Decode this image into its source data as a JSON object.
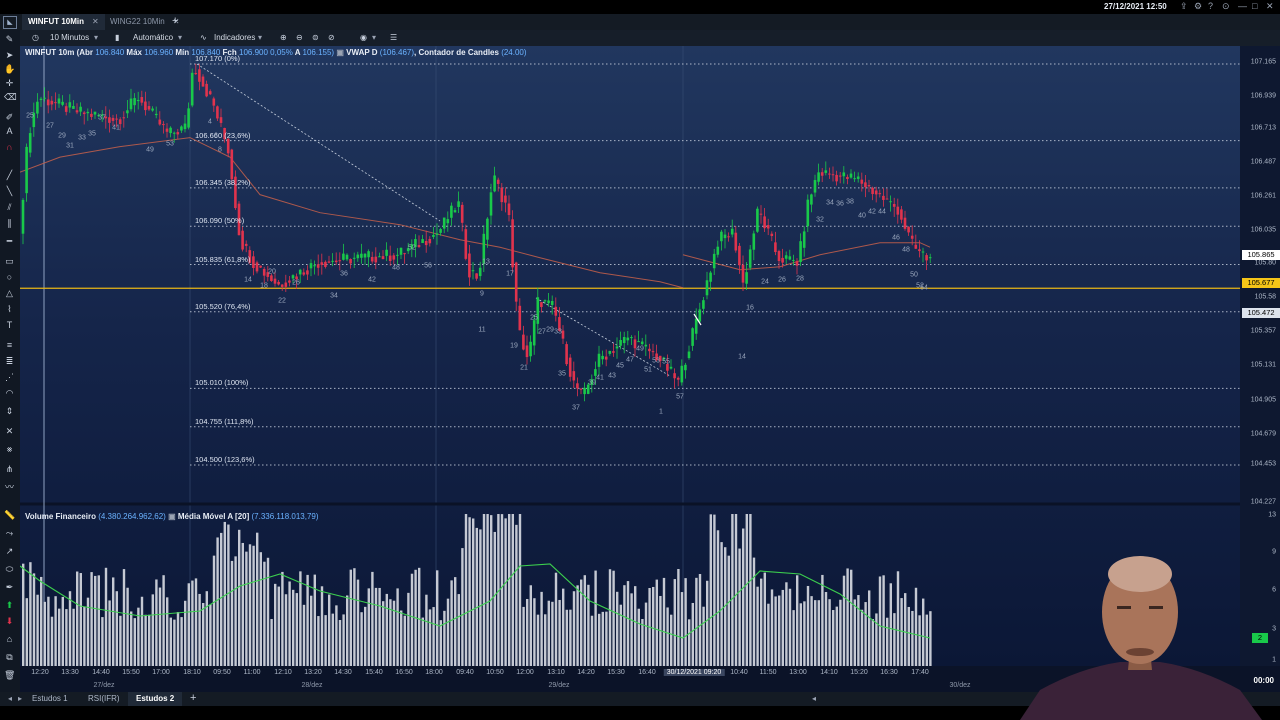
{
  "topbar": {
    "datetime": "27/12/2021 12:50"
  },
  "tabs": [
    {
      "label": "WINFUT 10Min",
      "active": true
    },
    {
      "label": "WING22 10Min",
      "active": false
    }
  ],
  "toolbar": {
    "interval": "10 Minutos",
    "mode": "Automático",
    "indicators": "Indicadores"
  },
  "legend_main": {
    "symbol": "WINFUT 10m",
    "abr_label": "(Abr",
    "abr": "106.840",
    "max_label": "Máx",
    "max": "106.960",
    "min_label": "Mín",
    "min": "106.840",
    "fch_label": "Fch",
    "fch": "106.900",
    "change": "0,05%",
    "a_label": "A",
    "a": "106.155)",
    "vwap_label": "VWAP D",
    "vwap": "(106.467)",
    "candles_label": "Contador de Candles",
    "candles": "(24.00)"
  },
  "legend_volume": {
    "label": "Volume Financeiro",
    "value": "(4.380.264.962,62)",
    "ma_label": "Média Móvel A [20]",
    "ma_value": "(7.336.118.013,79)"
  },
  "fib_levels": [
    {
      "label": "107.170 (0%)",
      "price": 107.17
    },
    {
      "label": "106.660 (23,6%)",
      "price": 106.66
    },
    {
      "label": "106.345 (38,2%)",
      "price": 106.345
    },
    {
      "label": "106.090 (50%)",
      "price": 106.09
    },
    {
      "label": "105.835 (61,8%)",
      "price": 105.835
    },
    {
      "label": "105.520 (76,4%)",
      "price": 105.52
    },
    {
      "label": "105.010 (100%)",
      "price": 105.01
    },
    {
      "label": "104.755 (111,8%)",
      "price": 104.755
    },
    {
      "label": "104.500 (123,6%)",
      "price": 104.5
    }
  ],
  "price_axis": {
    "labels": [
      "107.165",
      "106.939",
      "106.713",
      "106.487",
      "106.261",
      "106.035",
      "105.80",
      "105.58",
      "105.357",
      "105.131",
      "104.905",
      "104.679",
      "104.453",
      "104.227"
    ],
    "badges": [
      {
        "value": "105.865",
        "color": "#ffffff",
        "text_color": "#000000"
      },
      {
        "value": "105.677",
        "color": "#f5c518",
        "text_color": "#000000"
      },
      {
        "value": "105.472",
        "color": "#dde3ec",
        "text_color": "#000000"
      }
    ],
    "volume_labels": [
      "13",
      "9",
      "6",
      "3",
      "1"
    ],
    "volume_badge": "2",
    "volume_badge_color": "#19c94a"
  },
  "time_axis": {
    "labels": [
      "12:20",
      "13:30",
      "14:40",
      "15:50",
      "17:00",
      "18:10",
      "09:50",
      "11:00",
      "12:10",
      "13:20",
      "14:30",
      "15:40",
      "16:50",
      "18:00",
      "09:40",
      "10:50",
      "12:00",
      "13:10",
      "14:20",
      "15:30",
      "16:40",
      "30/12/2021 09:20",
      "10:40",
      "11:50",
      "13:00",
      "14:10",
      "15:20",
      "16:30",
      "17:40"
    ],
    "dates": [
      "27/dez",
      "28/dez",
      "29/dez",
      "30/dez"
    ],
    "clock": "00:00"
  },
  "bottom_tabs": [
    {
      "label": "Estudos 1",
      "active": false
    },
    {
      "label": "RSI(IFR)",
      "active": false
    },
    {
      "label": "Estudos 2",
      "active": true
    }
  ],
  "candle_counts": [
    "25",
    "27",
    "29",
    "31",
    "33",
    "35",
    "37",
    "41",
    "49",
    "53",
    "4",
    "6",
    "8",
    "14",
    "18",
    "20",
    "22",
    "26",
    "34",
    "36",
    "42",
    "48",
    "52",
    "56",
    "9",
    "11",
    "13",
    "17",
    "19",
    "21",
    "25",
    "27",
    "29",
    "33",
    "35",
    "37",
    "39",
    "41",
    "43",
    "45",
    "47",
    "49",
    "51",
    "53",
    "55",
    "57",
    "1",
    "14",
    "16",
    "24",
    "26",
    "28",
    "32",
    "34",
    "36",
    "38",
    "40",
    "42",
    "44",
    "46",
    "48",
    "50",
    "52",
    "54",
    "56"
  ],
  "colors": {
    "bull": "#19c94a",
    "bear": "#e0334d",
    "vwap": "#c8604a",
    "volume_ma": "#3ccf4e",
    "volume_bar": "#d9dde4",
    "hline": "#e8b615"
  }
}
